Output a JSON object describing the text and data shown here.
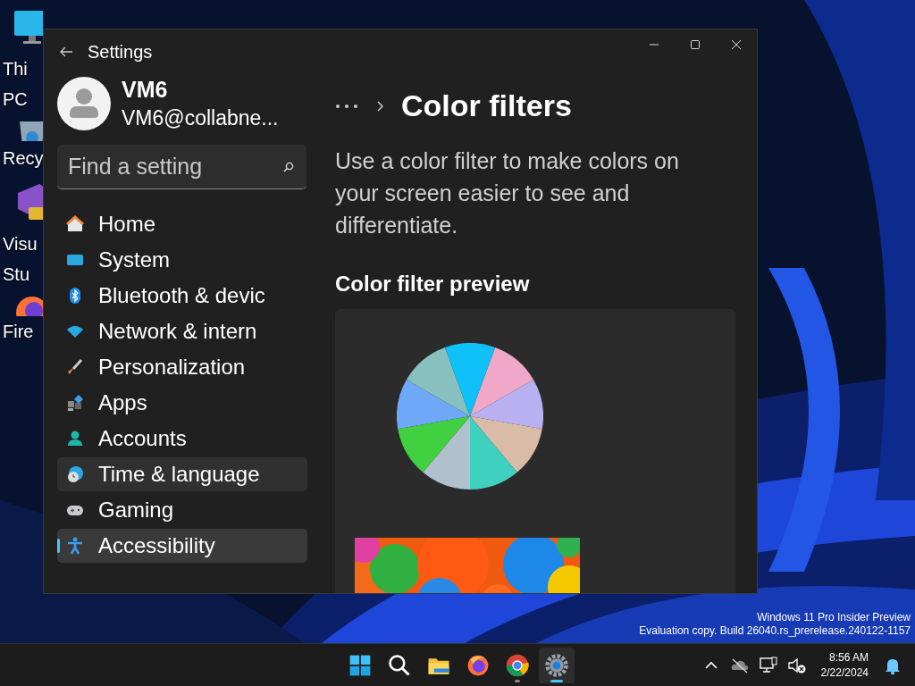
{
  "desktop": {
    "icons": [
      {
        "kind": "monitor",
        "lines": [
          "Thi",
          "PC"
        ]
      },
      {
        "kind": "bin",
        "lines": [
          "Recy"
        ]
      },
      {
        "kind": "studio",
        "lines": [
          "Visu",
          "Stu"
        ]
      },
      {
        "kind": "firefox",
        "lines": [
          "Fire"
        ]
      }
    ],
    "watermark": [
      "Windows 11 Pro Insider Preview",
      "Evaluation copy. Build 26040.rs_prerelease.240122-1157"
    ]
  },
  "window": {
    "title": "Settings",
    "user": {
      "name": "VM6",
      "email": "VM6@collabne..."
    },
    "search": {
      "placeholder": "Find a setting"
    },
    "nav": [
      {
        "kind": "home",
        "label": "Home",
        "selected": false,
        "hovered": false
      },
      {
        "kind": "system",
        "label": "System",
        "selected": false,
        "hovered": false
      },
      {
        "kind": "bluetooth",
        "label": "Bluetooth & devic",
        "selected": false,
        "hovered": false
      },
      {
        "kind": "network",
        "label": "Network & intern",
        "selected": false,
        "hovered": false
      },
      {
        "kind": "brush",
        "label": "Personalization",
        "selected": false,
        "hovered": false
      },
      {
        "kind": "apps",
        "label": "Apps",
        "selected": false,
        "hovered": false
      },
      {
        "kind": "accounts",
        "label": "Accounts",
        "selected": false,
        "hovered": false
      },
      {
        "kind": "time",
        "label": "Time & language",
        "selected": false,
        "hovered": true
      },
      {
        "kind": "gaming",
        "label": "Gaming",
        "selected": false,
        "hovered": false
      },
      {
        "kind": "accessibility",
        "label": "Accessibility",
        "selected": true,
        "hovered": false
      }
    ],
    "page_title": "Color filters",
    "description": "Use a color filter to make colors on your screen easier to see and differentiate.",
    "section_title": "Color filter preview"
  },
  "taskbar": {
    "apps": [
      {
        "kind": "start",
        "active": false,
        "running": false
      },
      {
        "kind": "search",
        "active": false,
        "running": false
      },
      {
        "kind": "explorer",
        "active": false,
        "running": false
      },
      {
        "kind": "firefox",
        "active": false,
        "running": false
      },
      {
        "kind": "chrome",
        "active": false,
        "running": true
      },
      {
        "kind": "settings",
        "active": true,
        "running": true
      }
    ],
    "time": "8:56 AM",
    "date": "2/22/2024"
  }
}
